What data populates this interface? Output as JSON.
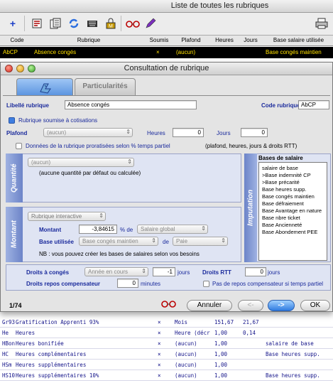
{
  "back_window": {
    "title": "Liste de toutes les rubriques",
    "columns": [
      "Code",
      "Rubrique",
      "Soumis",
      "Plafond",
      "Heures",
      "Jours",
      "Base salaire utilisée"
    ],
    "selected_row": {
      "code": "AbCP",
      "rubrique": "Absence congés",
      "soumis": "×",
      "plafond": "(aucun)",
      "heures": "",
      "jours": "",
      "base": "Base congés maintien"
    },
    "rows": [
      {
        "code": "Gr93",
        "rubrique": "Gratification Apprenti 93%",
        "soumis": "×",
        "plafond": "Mois",
        "heures": "151,67",
        "jours": "21,67",
        "base": ""
      },
      {
        "code": "He",
        "rubrique": "Heures",
        "soumis": "×",
        "plafond": "Heure (décr",
        "heures": "1,00",
        "jours": "0,14",
        "base": ""
      },
      {
        "code": "HBon",
        "rubrique": "Heures bonifiée",
        "soumis": "×",
        "plafond": "(aucun)",
        "heures": "1,00",
        "jours": "",
        "base": "salaire de base"
      },
      {
        "code": "HC",
        "rubrique": "Heures complémentaires",
        "soumis": "×",
        "plafond": "(aucun)",
        "heures": "1,00",
        "jours": "",
        "base": "Base heures supp."
      },
      {
        "code": "HSm",
        "rubrique": "Heures supplémentaires",
        "soumis": "×",
        "plafond": "(aucun)",
        "heures": "1,00",
        "jours": "",
        "base": ""
      },
      {
        "code": "HS10",
        "rubrique": "Heures supplémentaires 10%",
        "soumis": "×",
        "plafond": "(aucun)",
        "heures": "1,00",
        "jours": "",
        "base": "Base heures supp."
      }
    ]
  },
  "dialog": {
    "title": "Consultation de rubrique",
    "tabs": [
      "",
      "Particularités"
    ],
    "libelle_label": "Libellé rubrique",
    "libelle_value": "Absence congés",
    "code_label": "Code rubrique",
    "code_value": "AbCP",
    "soumise_label": "Rubrique soumise à cotisations",
    "plafond_label": "Plafond",
    "plafond_value": "(aucun)",
    "heures_label": "Heures",
    "heures_value": "0",
    "jours_label": "Jours",
    "jours_value": "0",
    "prorata_label": "Données de la rubrique proratisées selon % temps partiel",
    "prorata_note": "(plafond, heures, jours & droits RTT)",
    "quantite_side": "Quantité",
    "quantite_popup": "(aucun)",
    "quantite_note": "(aucune quantité par défaut ou calculée)",
    "montant_side": "Montant",
    "montant_type": "Rubrique interactive",
    "montant_label": "Montant",
    "montant_value": "-3,84615",
    "pct_de": "% de",
    "montant_base_popup": "Salaire global",
    "base_utilisee_label": "Base utilisée",
    "base_utilisee_value": "Base congés maintien",
    "de": "de",
    "paie_value": "Paie",
    "nb_note": "NB : vous pouvez créer les bases de salaires selon vos besoins",
    "imputation_side": "Imputation",
    "bases_header": "Bases de salaire",
    "bases": [
      "salaire de base",
      ">Base indemnité CP",
      ">Base précarité",
      "Base heures supp.",
      "Base congés maintien",
      "Base défraiement",
      "Base Avantage en nature",
      "Base nbre ticket",
      "Base  Ancienneté",
      "Base Abondement PEE"
    ],
    "droits_conges_label": "Droits à congés",
    "droits_conges_popup": "Année en cours",
    "droits_conges_value": "-1",
    "jours_unit": "jours",
    "droits_rtt_label": "Droits RTT",
    "droits_rtt_value": "0",
    "jours_unit2": "jours",
    "repos_label": "Droits repos compensateur",
    "repos_value": "0",
    "minutes_unit": "minutes",
    "pas_repos_label": "Pas de repos compensateur si temps partiel",
    "record_pos": "1/74",
    "annuler": "Annuler",
    "prev": "<-",
    "next": "->",
    "ok": "OK"
  }
}
